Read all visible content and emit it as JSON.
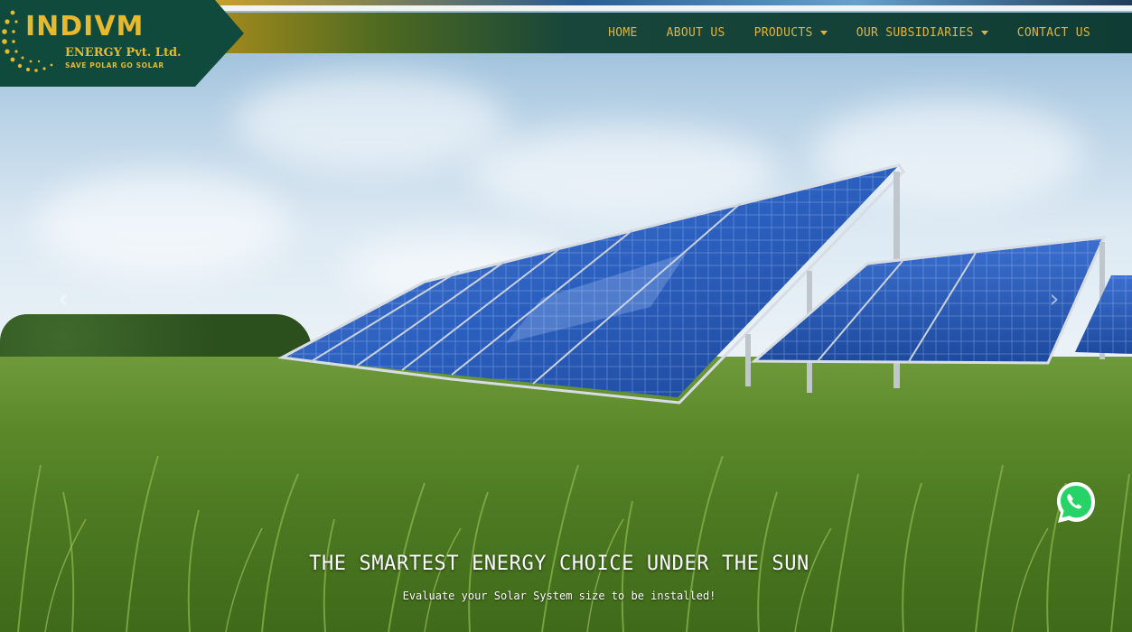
{
  "brand": {
    "name": "INDIVM",
    "company": "ENERGY Pvt. Ltd.",
    "tagline": "SAVE POLAR GO SOLAR"
  },
  "nav": {
    "items": [
      {
        "label": "HOME",
        "dropdown": false
      },
      {
        "label": "ABOUT US",
        "dropdown": false
      },
      {
        "label": "PRODUCTS",
        "dropdown": true
      },
      {
        "label": "OUR SUBSIDIARIES",
        "dropdown": true
      },
      {
        "label": "CONTACT US",
        "dropdown": false
      }
    ]
  },
  "hero": {
    "title": "THE SMARTEST ENERGY CHOICE UNDER THE SUN",
    "subtitle": "Evaluate your Solar System size to be installed!",
    "prev_glyph": "‹",
    "next_glyph": "›"
  },
  "colors": {
    "brand_green": "#0f4a3d",
    "brand_gold": "#e6b92e",
    "nav_text": "#e0b43c",
    "whatsapp_green": "#25d366"
  },
  "icons": {
    "whatsapp": "whatsapp-icon",
    "prev": "chevron-left-icon",
    "next": "chevron-right-icon",
    "dropdown": "caret-down-icon"
  }
}
